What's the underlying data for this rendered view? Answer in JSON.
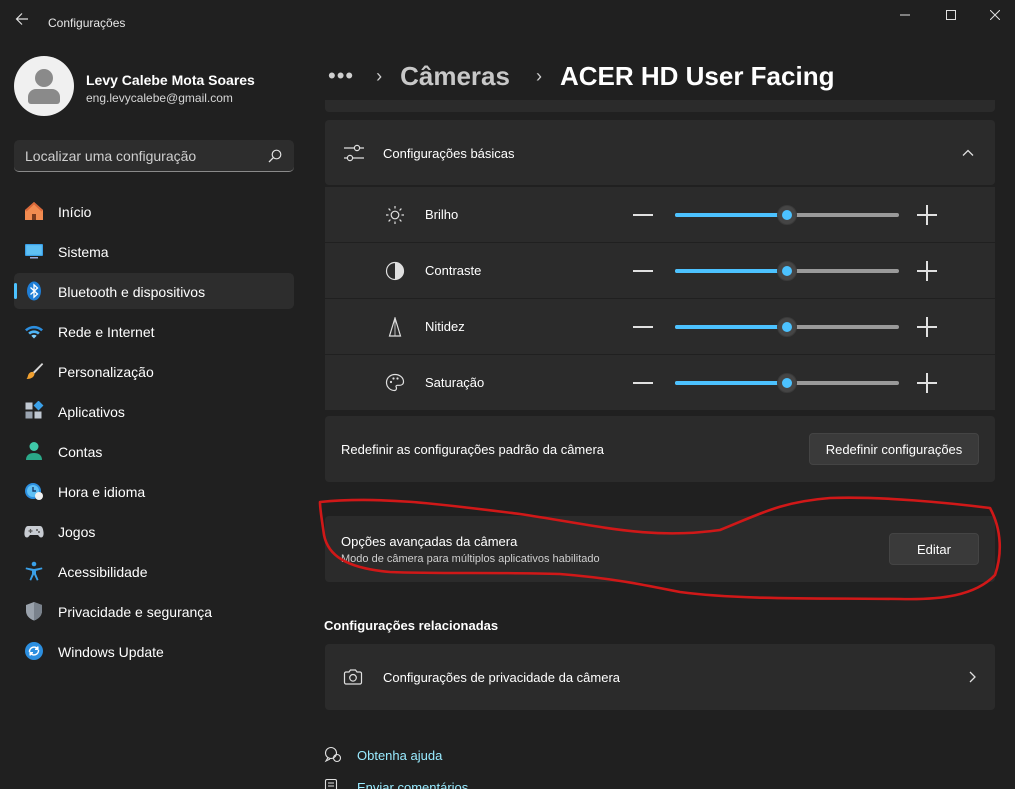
{
  "window": {
    "title": "Configurações",
    "back_icon": "arrow-left-icon",
    "controls": [
      "minimize-icon",
      "maximize-icon",
      "close-icon"
    ]
  },
  "profile": {
    "name": "Levy Calebe Mota Soares",
    "email": "eng.levycalebe@gmail.com"
  },
  "search": {
    "placeholder": "Localizar uma configuração",
    "icon": "search-icon"
  },
  "sidebar": {
    "items": [
      {
        "label": "Início",
        "icon": "home-icon"
      },
      {
        "label": "Sistema",
        "icon": "monitor-icon"
      },
      {
        "label": "Bluetooth e dispositivos",
        "icon": "bluetooth-icon",
        "active": true
      },
      {
        "label": "Rede e Internet",
        "icon": "wifi-icon"
      },
      {
        "label": "Personalização",
        "icon": "brush-icon"
      },
      {
        "label": "Aplicativos",
        "icon": "apps-icon"
      },
      {
        "label": "Contas",
        "icon": "account-icon"
      },
      {
        "label": "Hora e idioma",
        "icon": "clock-globe-icon"
      },
      {
        "label": "Jogos",
        "icon": "gamepad-icon"
      },
      {
        "label": "Acessibilidade",
        "icon": "accessibility-icon"
      },
      {
        "label": "Privacidade e segurança",
        "icon": "shield-icon"
      },
      {
        "label": "Windows Update",
        "icon": "update-icon"
      }
    ]
  },
  "breadcrumb": {
    "dots": "•••",
    "sep": "›",
    "parent": "Câmeras",
    "current": "ACER HD User Facing"
  },
  "basic": {
    "header": "Configurações básicas",
    "sliders": [
      {
        "label": "Brilho",
        "icon": "brightness-icon",
        "value_pct": 50
      },
      {
        "label": "Contraste",
        "icon": "contrast-icon",
        "value_pct": 50
      },
      {
        "label": "Nitidez",
        "icon": "sharpness-icon",
        "value_pct": 50
      },
      {
        "label": "Saturação",
        "icon": "palette-icon",
        "value_pct": 50
      }
    ]
  },
  "reset": {
    "label": "Redefinir as configurações padrão da câmera",
    "button": "Redefinir configurações"
  },
  "advanced": {
    "title": "Opções avançadas da câmera",
    "subtitle": "Modo de câmera para múltiplos aplicativos habilitado",
    "button": "Editar"
  },
  "related": {
    "title": "Configurações relacionadas",
    "privacy_label": "Configurações de privacidade da câmera"
  },
  "help": {
    "get_help": "Obtenha ajuda",
    "feedback": "Enviar comentários"
  },
  "colors": {
    "accent": "#4cc2ff",
    "background": "#202020",
    "card": "#2b2b2b",
    "annotation": "#d01818"
  }
}
